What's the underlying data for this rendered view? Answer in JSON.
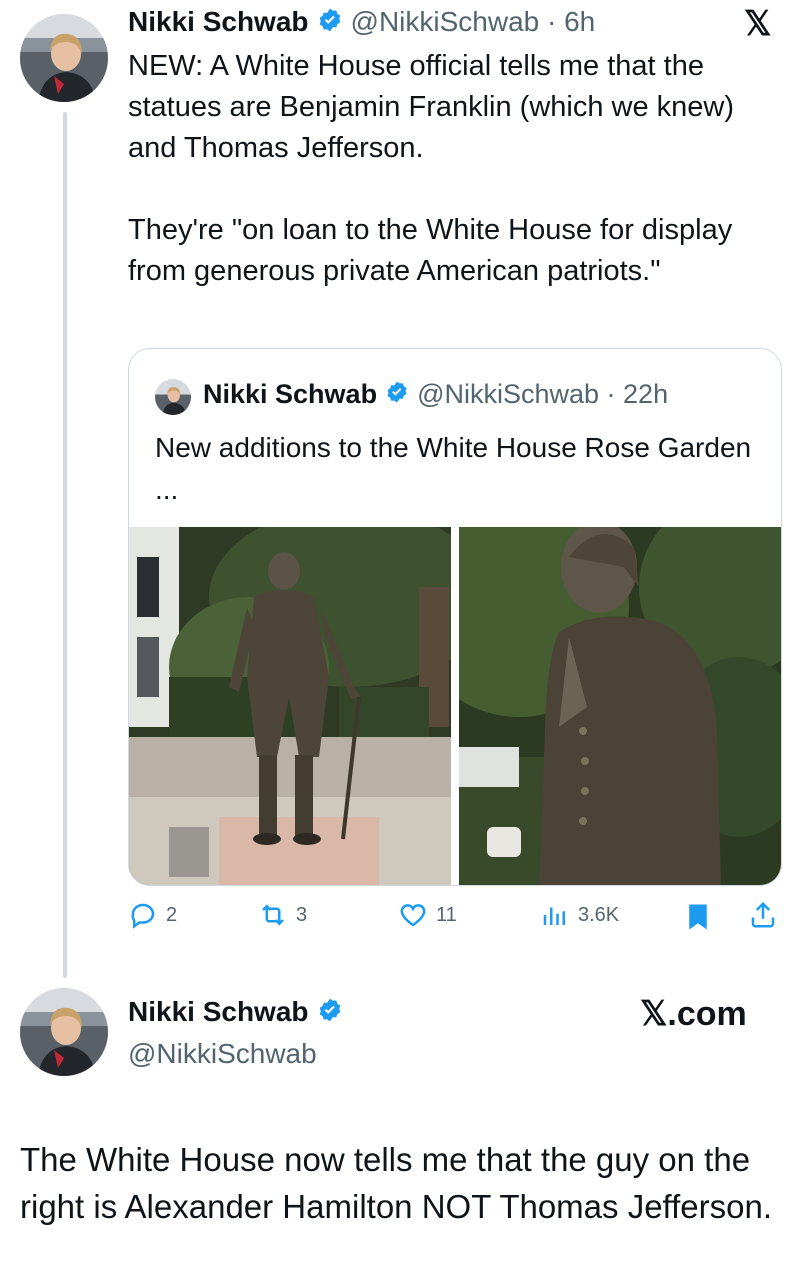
{
  "tweet": {
    "name": "Nikki Schwab",
    "handle_time": "@NikkiSchwab · 6h",
    "logo": "𝕏",
    "paragraphs": [
      "NEW: A White House official tells me that the statues are Benjamin Franklin (which we knew) and Thomas Jefferson.",
      "They're \"on loan to the White House for display from generous private American patriots.\""
    ]
  },
  "quoted": {
    "name": "Nikki Schwab",
    "handle_time": "@NikkiSchwab · 22h",
    "text": "New additions to the White House Rose Garden ..."
  },
  "actions": {
    "replies": "2",
    "reposts": "3",
    "likes": "11",
    "views": "3.6K"
  },
  "post": {
    "name": "Nikki Schwab",
    "handle": "@NikkiSchwab",
    "brand": "𝕏.com",
    "text": "The White House now tells me that the guy on the right is Alexander Hamilton NOT Thomas Jefferson."
  },
  "icons": {
    "verified": "verified-badge-icon",
    "reply": "reply-icon",
    "repost": "repost-icon",
    "like": "heart-icon",
    "views": "views-icon",
    "bookmark": "bookmark-icon",
    "share": "share-icon"
  },
  "colors": {
    "verified": "#1d9bf0",
    "bookmark": "#1d9bf0",
    "secondary_text": "#536471",
    "border": "#cfd9de"
  }
}
